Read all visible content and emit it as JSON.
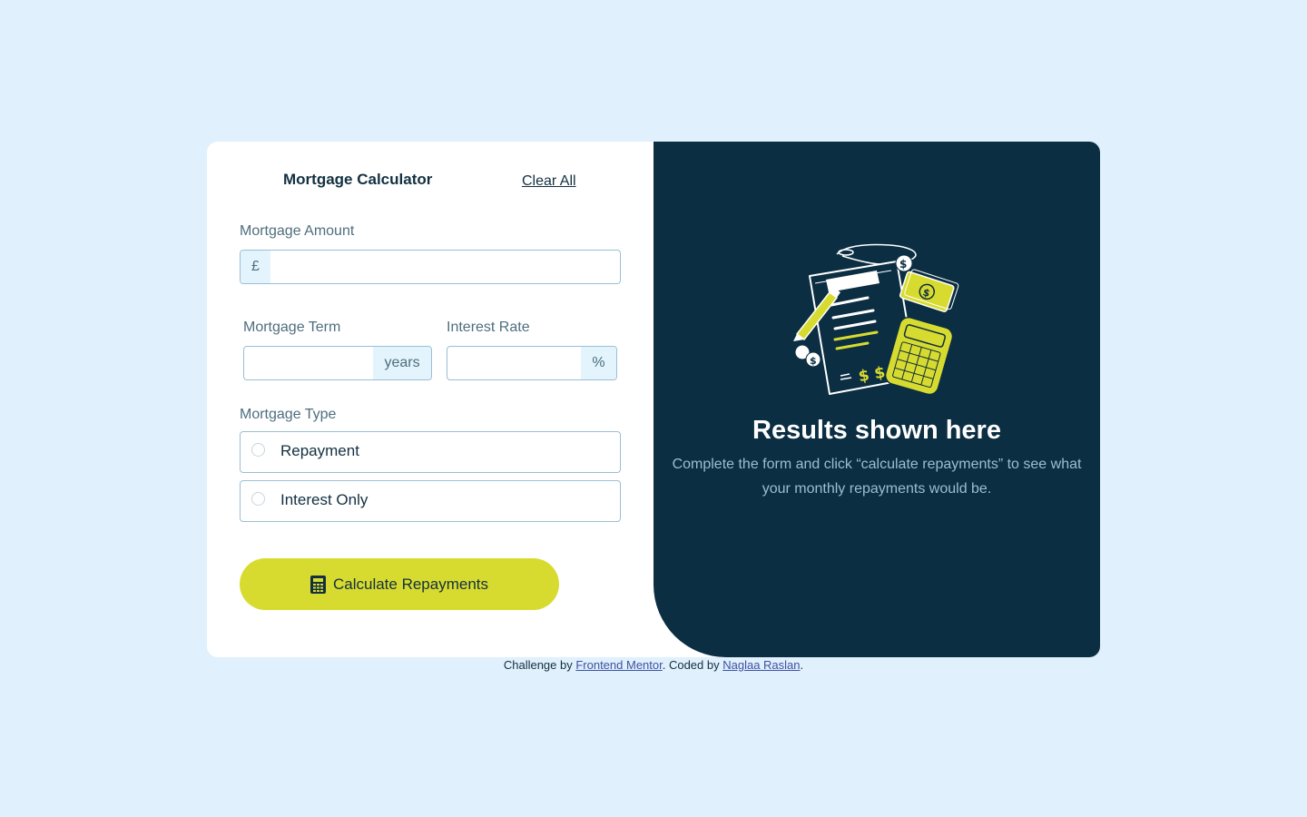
{
  "form": {
    "title": "Mortgage Calculator",
    "clear_all_label": "Clear All",
    "amount": {
      "label": "Mortgage Amount",
      "unit": "£",
      "value": "",
      "placeholder": ""
    },
    "term": {
      "label": "Mortgage Term",
      "unit": "years",
      "value": "",
      "placeholder": ""
    },
    "rate": {
      "label": "Interest Rate",
      "unit": "%",
      "value": "",
      "placeholder": ""
    },
    "type": {
      "label": "Mortgage Type",
      "options": [
        {
          "label": "Repayment",
          "selected": false
        },
        {
          "label": "Interest Only",
          "selected": false
        }
      ]
    },
    "submit_label": "Calculate Repayments",
    "submit_icon": "calculator-icon"
  },
  "results": {
    "illustration": "empty-results-illustration",
    "title": "Results shown here",
    "text": "Complete the form and click “calculate repayments” to see what your monthly repayments would be."
  },
  "attribution": {
    "prefix": "Challenge by ",
    "link1": "Frontend Mentor",
    "middle": ". Coded by ",
    "link2": "Naglaa Raslan",
    "suffix": "."
  },
  "colors": {
    "page_background": "#e0f0fc",
    "card_background": "#ffffff",
    "results_background": "#0b2e42",
    "accent_lime": "#d8db2f",
    "text_dark": "#133041",
    "text_muted": "#4e6e7e",
    "text_results": "#9abed5",
    "input_border": "#9abed5",
    "unit_background": "#e3f4fc",
    "link": "#3e52a3"
  }
}
